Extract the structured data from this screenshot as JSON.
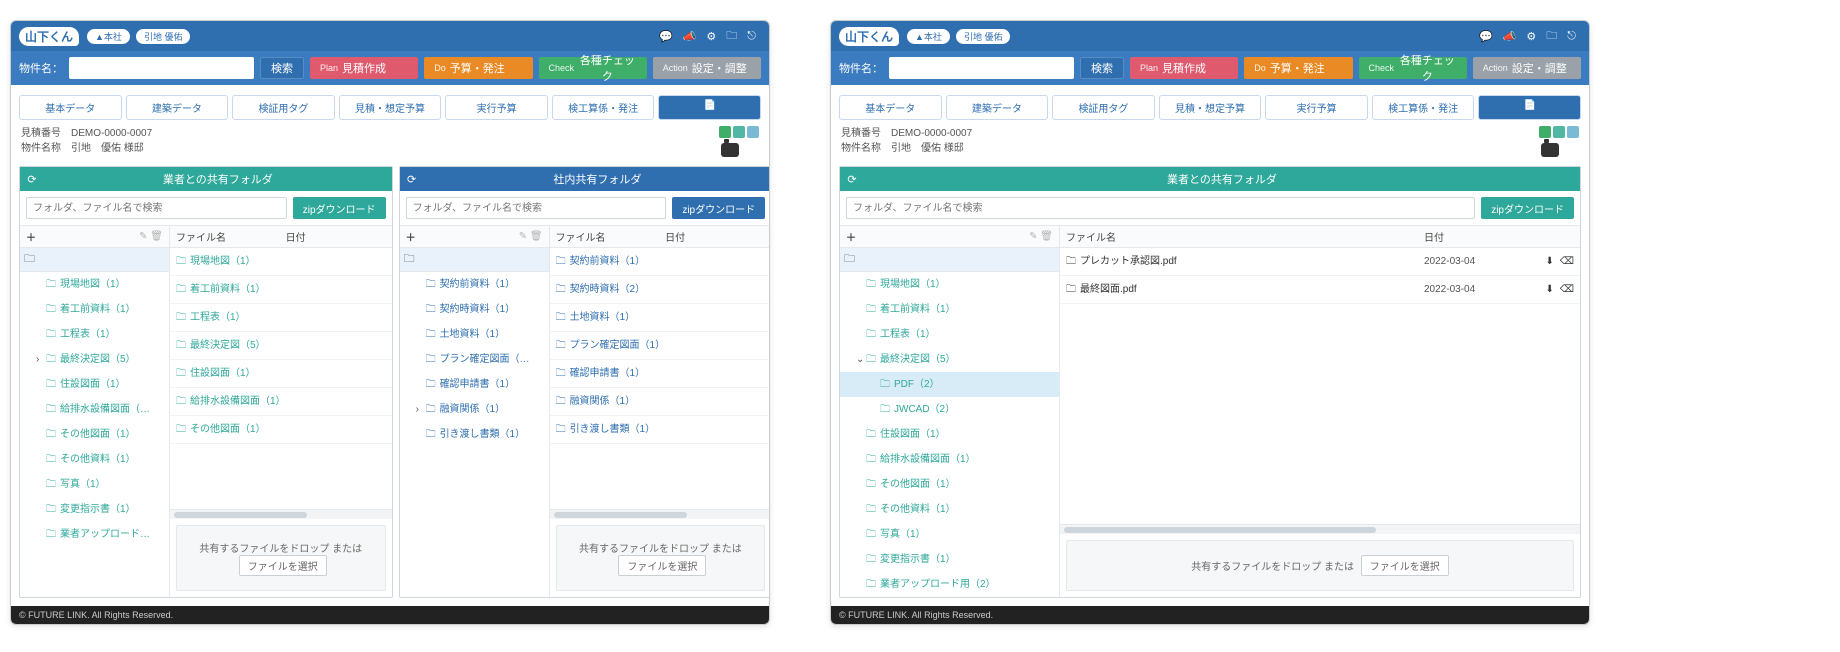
{
  "topbar": {
    "logo": "山下くん",
    "badges": [
      "▲本社",
      "引地 優佑"
    ],
    "icons": [
      "comment",
      "bullhorn",
      "gear",
      "folder",
      "exit"
    ]
  },
  "search": {
    "label": "物件名：",
    "placeholder": "",
    "search_btn": "検索",
    "plan": {
      "pre": "Plan",
      "label": "見積作成"
    },
    "do": {
      "pre": "Do",
      "label": "予算・発注"
    },
    "check": {
      "pre": "Check",
      "label": "各種チェック"
    },
    "action": {
      "pre": "Action",
      "label": "設定・調整"
    }
  },
  "tabs": [
    "基本データ",
    "建築データ",
    "検証用タグ",
    "見積・想定予算",
    "実行予算",
    "検工算係・発注",
    ""
  ],
  "tabs_icon_last": "📄",
  "meta": {
    "l1_label": "見積番号",
    "l1_value": "DEMO-0000-0007",
    "l2_label": "物件名称",
    "l2_value": "引地　優佑 様邸"
  },
  "panelA": {
    "title": "業者との共有フォルダ",
    "search_placeholder": "フォルダ、ファイル名で検索",
    "zip": "zipダウンロード",
    "file_header": {
      "name": "ファイル名",
      "date": "日付"
    },
    "tree": [
      {
        "label": "現場地図（1）"
      },
      {
        "label": "着工前資料（1）"
      },
      {
        "label": "工程表（1）"
      },
      {
        "label": "最終決定図（5）",
        "caret": "›"
      },
      {
        "label": "住設図面（1）"
      },
      {
        "label": "給排水設備図面（…"
      },
      {
        "label": "その他図面（1）"
      },
      {
        "label": "その他資料（1）"
      },
      {
        "label": "写真（1）"
      },
      {
        "label": "変更指示書（1）"
      },
      {
        "label": "業者アップロード…"
      }
    ],
    "files": [
      {
        "name": "現場地図（1）"
      },
      {
        "name": "着工前資料（1）"
      },
      {
        "name": "工程表（1）"
      },
      {
        "name": "最終決定図（5）"
      },
      {
        "name": "住設図面（1）"
      },
      {
        "name": "給排水設備図面（1）"
      },
      {
        "name": "その他図面（1）"
      }
    ],
    "drop_label": "共有するファイルをドロップ または",
    "pick_label": "ファイルを選択"
  },
  "panelB": {
    "title": "社内共有フォルダ",
    "search_placeholder": "フォルダ、ファイル名で検索",
    "zip": "zipダウンロード",
    "file_header": {
      "name": "ファイル名",
      "date": "日付"
    },
    "tree": [
      {
        "label": "契約前資料（1）"
      },
      {
        "label": "契約時資料（1）"
      },
      {
        "label": "土地資料（1）"
      },
      {
        "label": "プラン確定図面（…"
      },
      {
        "label": "確認申請書（1）"
      },
      {
        "label": "融資関係（1）",
        "caret": "›"
      },
      {
        "label": "引き渡し書類（1）"
      }
    ],
    "files": [
      {
        "name": "契約前資料（1）"
      },
      {
        "name": "契約時資料（2）"
      },
      {
        "name": "土地資料（1）"
      },
      {
        "name": "プラン確定図面（1）"
      },
      {
        "name": "確認申請書（1）"
      },
      {
        "name": "融資関係（1）"
      },
      {
        "name": "引き渡し書類（1）"
      }
    ],
    "drop_label": "共有するファイルをドロップ または",
    "pick_label": "ファイルを選択"
  },
  "panelC": {
    "title": "業者との共有フォルダ",
    "search_placeholder": "フォルダ、ファイル名で検索",
    "zip": "zipダウンロード",
    "file_header": {
      "name": "ファイル名",
      "date": "日付"
    },
    "tree": [
      {
        "label": "現場地図（1）"
      },
      {
        "label": "着工前資料（1）"
      },
      {
        "label": "工程表（1）"
      },
      {
        "label": "最終決定図（5）",
        "caret": "⌄",
        "open": true
      },
      {
        "label": "PDF（2）",
        "child": true,
        "sel": true
      },
      {
        "label": "JWCAD（2）",
        "child": true
      },
      {
        "label": "住設図面（1）"
      },
      {
        "label": "給排水設備図面（1）"
      },
      {
        "label": "その他図面（1）"
      },
      {
        "label": "その他資料（1）"
      },
      {
        "label": "写真（1）"
      },
      {
        "label": "変更指示書（1）"
      },
      {
        "label": "業者アップロード用（2）"
      }
    ],
    "files": [
      {
        "name": "プレカット承認図.pdf",
        "date": "2022-03-04",
        "dl": true,
        "del": true
      },
      {
        "name": "最終図面.pdf",
        "date": "2022-03-04",
        "dl": true,
        "del": true
      }
    ],
    "drop_label": "共有するファイルをドロップ または",
    "pick_label": "ファイルを選択"
  },
  "footer": "© FUTURE LINK. All Rights Reserved."
}
